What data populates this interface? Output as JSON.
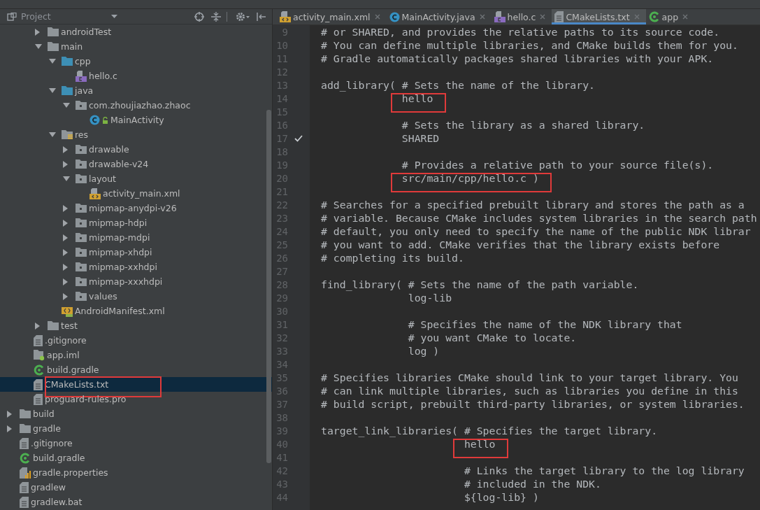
{
  "project_panel": {
    "title": "Project",
    "tree": [
      {
        "children": [
          {
            "children": [
              {
                "children": [
                  {
                    "label": "androidTest",
                    "kind": "folder",
                    "expanded": false,
                    "selected": false,
                    "highlighted": false
                  },
                  {
                    "label": "main",
                    "kind": "folder",
                    "expanded": true,
                    "selected": false,
                    "highlighted": false,
                    "children": [
                      {
                        "label": "cpp",
                        "kind": "source-folder",
                        "expanded": true,
                        "selected": false,
                        "highlighted": false,
                        "children": [
                          {
                            "label": "hello.c",
                            "kind": "c-file",
                            "selected": false,
                            "highlighted": false
                          }
                        ]
                      },
                      {
                        "label": "java",
                        "kind": "source-folder",
                        "expanded": true,
                        "selected": false,
                        "highlighted": false,
                        "children": [
                          {
                            "label": "com.zhoujiazhao.zhaoc",
                            "kind": "package",
                            "expanded": true,
                            "selected": false,
                            "highlighted": false,
                            "children": [
                              {
                                "label": "MainActivity",
                                "kind": "java-class",
                                "selected": false,
                                "highlighted": false
                              }
                            ]
                          }
                        ]
                      },
                      {
                        "label": "res",
                        "kind": "res-folder",
                        "expanded": true,
                        "selected": false,
                        "highlighted": false,
                        "children": [
                          {
                            "label": "drawable",
                            "kind": "package",
                            "expanded": false,
                            "selected": false,
                            "highlighted": false
                          },
                          {
                            "label": "drawable-v24",
                            "kind": "package",
                            "expanded": false,
                            "selected": false,
                            "highlighted": false
                          },
                          {
                            "label": "layout",
                            "kind": "package",
                            "expanded": true,
                            "selected": false,
                            "highlighted": false,
                            "children": [
                              {
                                "label": "activity_main.xml",
                                "kind": "xml-file",
                                "selected": false,
                                "highlighted": false
                              }
                            ]
                          },
                          {
                            "label": "mipmap-anydpi-v26",
                            "kind": "package",
                            "expanded": false,
                            "selected": false,
                            "highlighted": false
                          },
                          {
                            "label": "mipmap-hdpi",
                            "kind": "package",
                            "expanded": false,
                            "selected": false,
                            "highlighted": false
                          },
                          {
                            "label": "mipmap-mdpi",
                            "kind": "package",
                            "expanded": false,
                            "selected": false,
                            "highlighted": false
                          },
                          {
                            "label": "mipmap-xhdpi",
                            "kind": "package",
                            "expanded": false,
                            "selected": false,
                            "highlighted": false
                          },
                          {
                            "label": "mipmap-xxhdpi",
                            "kind": "package",
                            "expanded": false,
                            "selected": false,
                            "highlighted": false
                          },
                          {
                            "label": "mipmap-xxxhdpi",
                            "kind": "package",
                            "expanded": false,
                            "selected": false,
                            "highlighted": false
                          },
                          {
                            "label": "values",
                            "kind": "package",
                            "expanded": false,
                            "selected": false,
                            "highlighted": false
                          }
                        ]
                      },
                      {
                        "label": "AndroidManifest.xml",
                        "kind": "manifest",
                        "selected": false,
                        "highlighted": false
                      }
                    ]
                  },
                  {
                    "label": "test",
                    "kind": "folder",
                    "expanded": false,
                    "selected": false,
                    "highlighted": false
                  }
                ]
              },
              {
                "label": ".gitignore",
                "kind": "text-file",
                "selected": false,
                "highlighted": false
              },
              {
                "label": "app.iml",
                "kind": "iml-file",
                "selected": false,
                "highlighted": false
              },
              {
                "label": "build.gradle",
                "kind": "gradle-file",
                "selected": false,
                "highlighted": false
              },
              {
                "label": "CMakeLists.txt",
                "kind": "text-file",
                "selected": true,
                "highlighted": true
              },
              {
                "label": "proguard-rules.pro",
                "kind": "text-file",
                "selected": false,
                "highlighted": false
              }
            ]
          },
          {
            "label": "build",
            "kind": "folder",
            "expanded": false,
            "selected": false,
            "highlighted": false
          },
          {
            "label": "gradle",
            "kind": "folder",
            "expanded": false,
            "selected": false,
            "highlighted": false
          },
          {
            "label": ".gitignore",
            "kind": "text-file",
            "selected": false,
            "highlighted": false
          },
          {
            "label": "build.gradle",
            "kind": "gradle-file",
            "selected": false,
            "highlighted": false
          },
          {
            "label": "gradle.properties",
            "kind": "properties-file",
            "selected": false,
            "highlighted": false
          },
          {
            "label": "gradlew",
            "kind": "text-file",
            "selected": false,
            "highlighted": false
          },
          {
            "label": "gradlew.bat",
            "kind": "text-file",
            "selected": false,
            "highlighted": false
          }
        ]
      }
    ]
  },
  "editor": {
    "tabs": [
      {
        "label": "activity_main.xml",
        "kind": "xml-file",
        "selected": false
      },
      {
        "label": "MainActivity.java",
        "kind": "java-class",
        "selected": false
      },
      {
        "label": "hello.c",
        "kind": "c-file",
        "selected": false
      },
      {
        "label": "CMakeLists.txt",
        "kind": "text-file",
        "selected": true
      },
      {
        "label": "app",
        "kind": "gradle-file",
        "selected": false
      }
    ],
    "lines": [
      {
        "number": "9",
        "text": "# or SHARED, and provides the relative paths to its source code.",
        "checked": false,
        "highlighted": false
      },
      {
        "number": "10",
        "text": "# You can define multiple libraries, and CMake builds them for you.",
        "checked": false,
        "highlighted": false
      },
      {
        "number": "11",
        "text": "# Gradle automatically packages shared libraries with your APK.",
        "checked": false,
        "highlighted": false
      },
      {
        "number": "12",
        "checked": false,
        "highlighted": false
      },
      {
        "number": "13",
        "text": "add_library( # Sets the name of the library.",
        "checked": false,
        "highlighted": false
      },
      {
        "number": "14",
        "text": "             hello",
        "checked": false,
        "highlighted": true
      },
      {
        "number": "15",
        "checked": false,
        "highlighted": false
      },
      {
        "number": "16",
        "text": "             # Sets the library as a shared library.",
        "checked": false,
        "highlighted": false
      },
      {
        "number": "17",
        "text": "             SHARED",
        "checked": true,
        "highlighted": false
      },
      {
        "number": "18",
        "checked": false,
        "highlighted": false
      },
      {
        "number": "19",
        "text": "             # Provides a relative path to your source file(s).",
        "checked": false,
        "highlighted": false
      },
      {
        "number": "20",
        "text": "             src/main/cpp/hello.c )",
        "checked": false,
        "highlighted": true
      },
      {
        "number": "21",
        "checked": false,
        "highlighted": false
      },
      {
        "number": "22",
        "text": "# Searches for a specified prebuilt library and stores the path as a",
        "checked": false,
        "highlighted": false
      },
      {
        "number": "23",
        "text": "# variable. Because CMake includes system libraries in the search path",
        "checked": false,
        "highlighted": false
      },
      {
        "number": "24",
        "text": "# default, you only need to specify the name of the public NDK librar",
        "checked": false,
        "highlighted": false
      },
      {
        "number": "25",
        "text": "# you want to add. CMake verifies that the library exists before",
        "checked": false,
        "highlighted": false
      },
      {
        "number": "26",
        "text": "# completing its build.",
        "checked": false,
        "highlighted": false
      },
      {
        "number": "27",
        "checked": false,
        "highlighted": false
      },
      {
        "number": "28",
        "text": "find_library( # Sets the name of the path variable.",
        "checked": false,
        "highlighted": false
      },
      {
        "number": "29",
        "text": "              log-lib",
        "checked": false,
        "highlighted": false
      },
      {
        "number": "30",
        "checked": false,
        "highlighted": false
      },
      {
        "number": "31",
        "text": "              # Specifies the name of the NDK library that",
        "checked": false,
        "highlighted": false
      },
      {
        "number": "32",
        "text": "              # you want CMake to locate.",
        "checked": false,
        "highlighted": false
      },
      {
        "number": "33",
        "text": "              log )",
        "checked": false,
        "highlighted": false
      },
      {
        "number": "34",
        "checked": false,
        "highlighted": false
      },
      {
        "number": "35",
        "text": "# Specifies libraries CMake should link to your target library. You",
        "checked": false,
        "highlighted": false
      },
      {
        "number": "36",
        "text": "# can link multiple libraries, such as libraries you define in this",
        "checked": false,
        "highlighted": false
      },
      {
        "number": "37",
        "text": "# build script, prebuilt third-party libraries, or system libraries.",
        "checked": false,
        "highlighted": false
      },
      {
        "number": "38",
        "checked": false,
        "highlighted": false
      },
      {
        "number": "39",
        "text": "target_link_libraries( # Specifies the target library.",
        "checked": false,
        "highlighted": false
      },
      {
        "number": "40",
        "text": "                       hello",
        "checked": false,
        "highlighted": true
      },
      {
        "number": "41",
        "checked": false,
        "highlighted": false
      },
      {
        "number": "42",
        "text": "                       # Links the target library to the log library",
        "checked": false,
        "highlighted": false
      },
      {
        "number": "43",
        "text": "                       # included in the NDK.",
        "checked": false,
        "highlighted": false
      },
      {
        "number": "44",
        "text": "                       ${log-lib} )",
        "checked": false,
        "highlighted": false
      }
    ]
  }
}
